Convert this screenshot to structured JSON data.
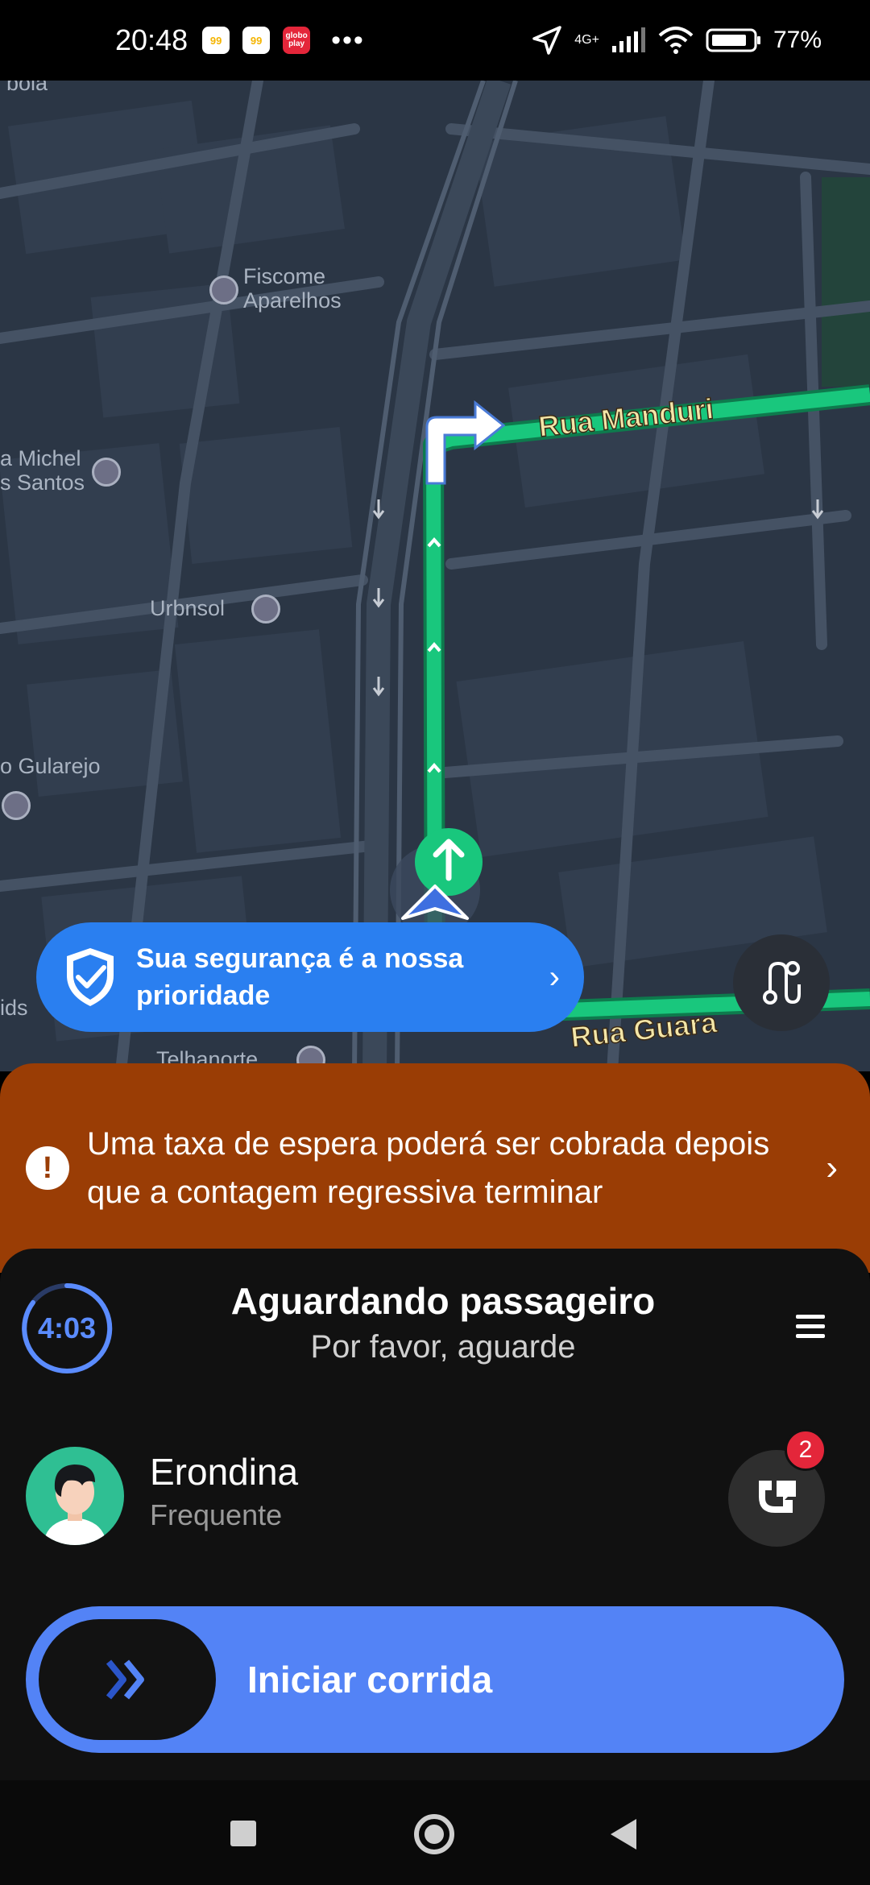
{
  "status_bar": {
    "time": "20:48",
    "badges": [
      "99",
      "99",
      "globo play"
    ],
    "overflow": "•••",
    "network": "4G+",
    "battery": "77%"
  },
  "map": {
    "streets": [
      "Rua Manduri",
      "Rua Guara"
    ],
    "pois": {
      "fiscome": "Fiscome\nAparelhos",
      "michel": "a Michel\ns Santos",
      "gularejo": "o Gularejo",
      "urbnsol": "Urbnsol",
      "telhanorte": "Telhanorte",
      "partial_top": "bola",
      "partial_left": "ids"
    },
    "route_color": "#19c77d",
    "background_color": "#2b3645"
  },
  "safety": {
    "label": "Sua segurança é a nossa prioridade",
    "icon": "shield-check-icon"
  },
  "banner": {
    "text": "Uma taxa de espera poderá ser cobrada depois que a contagem regressiva terminar",
    "color": "#9a3d05"
  },
  "sheet": {
    "timer": "4:03",
    "title": "Aguardando passageiro",
    "subtitle": "Por favor, aguarde",
    "passenger": {
      "name": "Erondina",
      "tag": "Frequente"
    },
    "call_badge": "2",
    "start_label": "Iniciar corrida",
    "accent": "#5383f6"
  }
}
